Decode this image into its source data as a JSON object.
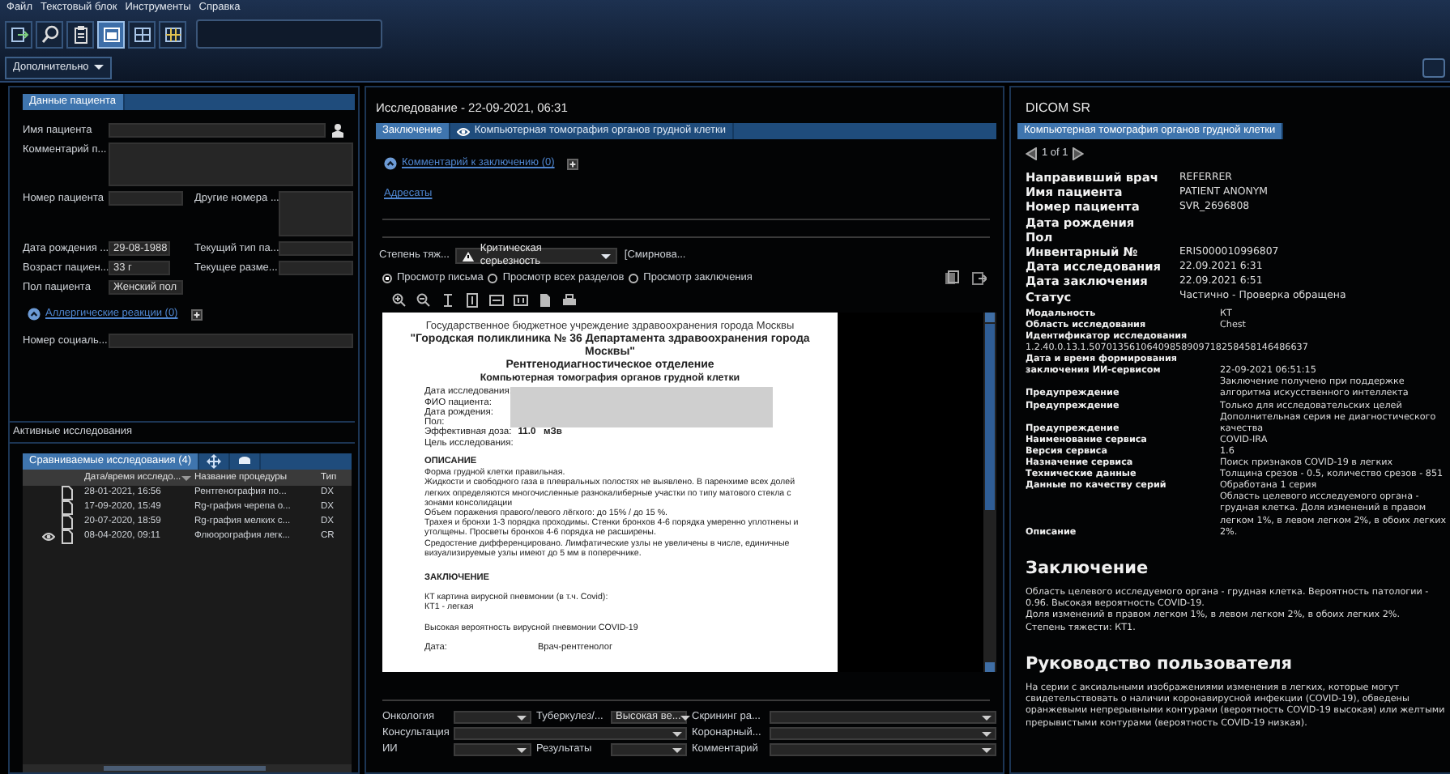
{
  "menu": [
    "Файл",
    "Текстовый блок",
    "Инструменты",
    "Справка"
  ],
  "toolbar": [
    {
      "kind": "exit",
      "selected": false
    },
    {
      "kind": "search",
      "selected": false
    },
    {
      "kind": "clipboard",
      "selected": false
    },
    {
      "kind": "layout1",
      "selected": true
    },
    {
      "kind": "layout2",
      "selected": false
    },
    {
      "kind": "layout3",
      "selected": false
    }
  ],
  "more_button": "Дополнительно",
  "patient": {
    "tab": "Данные пациента",
    "name_label": "Имя пациента",
    "comment_label": "Комментарий п...",
    "number_label": "Номер пациента",
    "other_numbers_label": "Другие номера ...",
    "birth_label": "Дата рождения ...",
    "birth": "29-08-1988",
    "current_type_label": "Текущий тип па...",
    "age_label": "Возраст пациен...",
    "age": "33 г",
    "current_size_label": "Текущее разме...",
    "sex_label": "Пол пациента",
    "sex": "Женский пол",
    "allergy_link": "Аллергические реакции (0)",
    "social_label": "Номер социаль..."
  },
  "studies": {
    "title": "Активные исследования",
    "tabs": [
      {
        "kind": "text",
        "label": "Сравниваемые исследования (4)",
        "selected": true
      },
      {
        "kind": "move",
        "selected": false
      },
      {
        "kind": "stack",
        "selected": false
      }
    ],
    "columns": [
      "Дата/время исследо...",
      "Название процедуры",
      "Тип"
    ],
    "rows": [
      {
        "viewed": false,
        "date": "28-01-2021, 16:56",
        "name": "Рентгенография по...",
        "type": "DX"
      },
      {
        "viewed": false,
        "date": "17-09-2020, 15:49",
        "name": "Rg-графия черепа о...",
        "type": "DX"
      },
      {
        "viewed": false,
        "date": "20-07-2020, 18:59",
        "name": "Rg-графия мелких с...",
        "type": "DX"
      },
      {
        "viewed": true,
        "date": "08-04-2020, 09:11",
        "name": "Флюорография легк...",
        "type": "CR"
      }
    ]
  },
  "study": {
    "title": "Исследование - 22-09-2021, 06:31",
    "tabs": [
      {
        "label": "Заключение",
        "selected": true,
        "viewed": false
      },
      {
        "label": "Компьютерная томография органов грудной клетки",
        "selected": false,
        "viewed": true
      }
    ],
    "comment_link": "Комментарий к заключению (0)",
    "recipients_link": "Адресаты",
    "severity_label": "Степень тяж...",
    "severity": "Критическая серьезность",
    "author": "[Смирнова...",
    "views": [
      {
        "label": "Просмотр письма",
        "selected": true
      },
      {
        "label": "Просмотр всех разделов",
        "selected": false
      },
      {
        "label": "Просмотр заключения",
        "selected": false
      }
    ],
    "document": {
      "org": "Государственное бюджетное учреждение здравоохранения города Москвы",
      "titles": [
        "\"Городская поликлиника № 36 Департамента здравоохранения города Москвы\"",
        "Рентгенодиагностическое отделение",
        "Компьютерная томография органов грудной клетки"
      ],
      "fields": [
        {
          "label": "Дата исследования:"
        },
        {
          "label": "ФИО пациента:"
        },
        {
          "label": "Дата рождения:"
        },
        {
          "label": "Пол:"
        },
        {
          "label": "Эффективная доза:",
          "value": "11.0   мЗв"
        },
        {
          "label": "Цель исследования:"
        }
      ],
      "sections": [
        {
          "kind": "compact",
          "heading": "ОПИСАНИЕ",
          "paragraphs": [
            "Форма грудной клетки правильная.",
            "Жидкости и свободного газа в плевральных полостях не выявлено.  В паренхиме всех долей легких определяются многочисленные разнокалиберные участки по типу матового стекла с зонами консолидации",
            "Объем поражения правого/левого лёгкого: до 15% / до 15 %.",
            "Трахея и бронхи 1-3 порядка проходимы. Стенки бронхов 4-6 порядка умеренно уплотнены и утолщены. Просветы бронхов 4-6 порядка не расширены.",
            "Средостение дифференцировано. Лимфатические узлы не увеличены в числе, единичные визуализируемые узлы имеют до 5 мм в поперечнике."
          ]
        },
        {
          "kind": "spaced",
          "heading": "ЗАКЛЮЧЕНИЕ",
          "paragraphs": [
            "КТ картина вирусной пневмонии (в т.ч. Covid):\nКТ1 - легкая",
            "Высокая вероятность вирусной пневмонии COVID-19"
          ]
        }
      ],
      "footer": [
        "Дата:",
        "Врач-рентгенолог"
      ]
    },
    "fields": [
      [
        {
          "kind": "narrow",
          "label": "Онкология"
        },
        {
          "kind": "narrow",
          "label": "Туберкулез/...",
          "value": "Высокая ве..."
        },
        {
          "kind": "wide",
          "label": "Скрининг ра..."
        }
      ],
      [
        {
          "kind": "double",
          "label": "Консультация"
        },
        {
          "kind": "wide",
          "label": "Коронарный..."
        }
      ],
      [
        {
          "kind": "narrow",
          "label": "ИИ"
        },
        {
          "kind": "narrow",
          "label": "Результаты"
        },
        {
          "kind": "wide",
          "label": "Комментарий"
        }
      ]
    ]
  },
  "report": {
    "title": "DICOM SR",
    "tab": "Компьютерная томография органов грудной клетки",
    "pager": "1 of 1",
    "main_rows": [
      {
        "label": "Направивший врач",
        "value": "REFERRER"
      },
      {
        "label": "Имя пациента",
        "value": "PATIENT ANONYM"
      },
      {
        "label": "Номер пациента",
        "value": "SVR_2696808"
      },
      {
        "label": "Дата рождения"
      },
      {
        "label": "Пол"
      },
      {
        "label": "Инвентарный №",
        "value": "ERIS000010996807"
      },
      {
        "label": "Дата исследования",
        "value": "22.09.2021 6:31"
      },
      {
        "label": "Дата заключения",
        "value": "22.09.2021 6:51"
      },
      {
        "label": "Статус",
        "value": "Частично - Проверка обращена"
      }
    ],
    "detail_rows": [
      {
        "kind": "inline",
        "label": "Модальность",
        "value": "КТ"
      },
      {
        "kind": "inline",
        "label": "Область исследования",
        "value": "Chest"
      },
      {
        "kind": "stacked",
        "label": "Идентификатор исследования",
        "value": "1.2.40.0.13.1.50701356106409858909718258458146486637"
      },
      {
        "kind": "inline",
        "label": "Дата и время формирования заключения ИИ-сервисом",
        "value": "22-09-2021 06:51:15"
      },
      {
        "kind": "inline",
        "label": "Предупреждение",
        "value": "Заключение получено при поддержке алгоритма искусственного интеллекта"
      },
      {
        "kind": "inline",
        "label": "Предупреждение",
        "value": "Только для исследовательских целей"
      },
      {
        "kind": "inline",
        "label": "Предупреждение",
        "value": "Дополнительная серия не диагностического качества"
      },
      {
        "kind": "inline",
        "label": "Наименование сервиса",
        "value": "COVID-IRA"
      },
      {
        "kind": "inline",
        "label": "Версия сервиса",
        "value": "1.6"
      },
      {
        "kind": "inline",
        "label": "Назначение сервиса",
        "value": "Поиск признаков COVID-19 в легких"
      },
      {
        "kind": "inline",
        "label": "Технические данные",
        "value": "Толщина срезов - 0.5, количество срезов - 851"
      },
      {
        "kind": "inline",
        "label": "Данные по качеству серий",
        "value": "Обработана 1 серия"
      },
      {
        "kind": "inline",
        "label": "Описание",
        "value": "Область целевого исследуемого органа - грудная клетка. Доля изменений в правом легком 1%, в левом легком 2%, в обоих легких 2%."
      }
    ],
    "sections": [
      {
        "heading": "Заключение",
        "paragraphs": [
          "Область целевого исследуемого органа - грудная клетка. Вероятность патологии - 0.96. Высокая вероятность COVID-19.",
          "Доля изменений в правом легком 1%, в левом легком 2%, в обоих легких 2%.",
          "Степень тяжести: КТ1."
        ]
      },
      {
        "heading": "Руководство пользователя",
        "paragraphs": [
          "На серии с аксиальными изображениями изменения в легких, которые могут свидетельствовать о наличии коронавирусной инфекции (COVID-19), обведены оранжевыми непрерывными контурами (вероятность COVID-19 высокая) или желтыми прерывистыми контурами (вероятность COVID-19 низкая)."
        ]
      }
    ]
  }
}
